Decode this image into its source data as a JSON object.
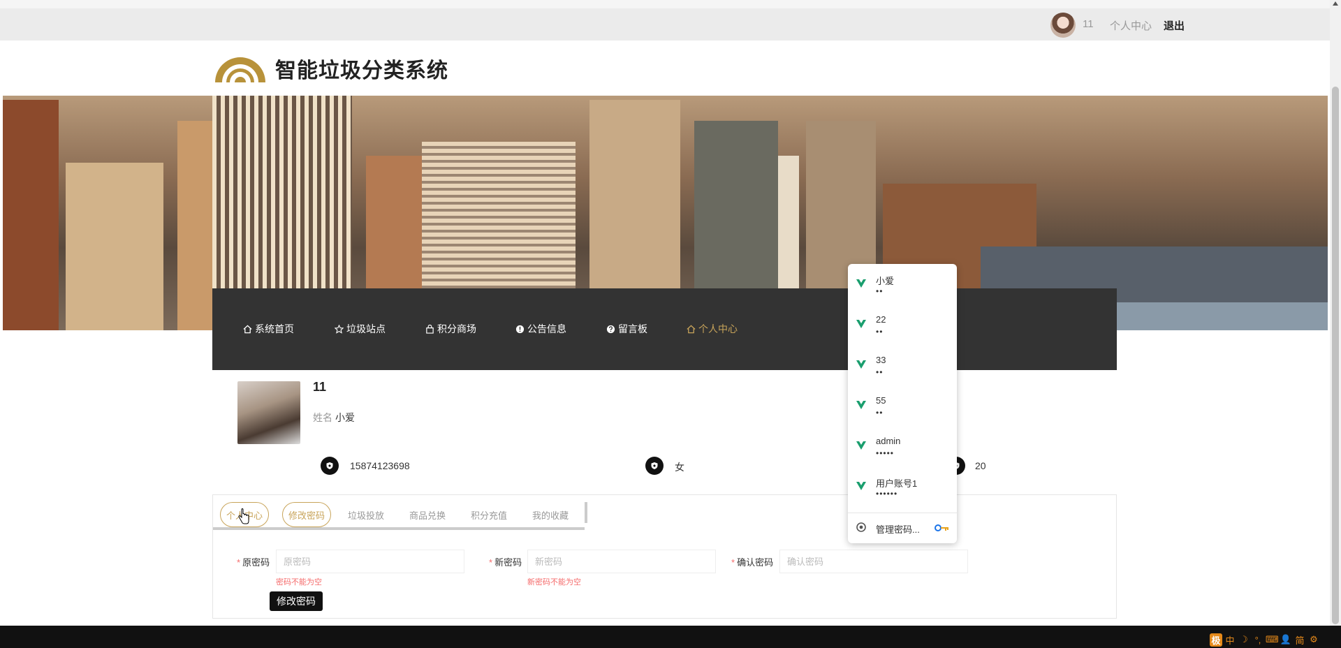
{
  "topbar": {
    "username": "11",
    "center_link": "个人中心",
    "logout": "退出"
  },
  "header": {
    "site_title": "智能垃圾分类系统"
  },
  "nav": {
    "items": [
      {
        "label": "系统首页",
        "icon": "home-icon"
      },
      {
        "label": "垃圾站点",
        "icon": "star-icon"
      },
      {
        "label": "积分商场",
        "icon": "bag-icon"
      },
      {
        "label": "公告信息",
        "icon": "info-icon"
      },
      {
        "label": "留言板",
        "icon": "question-icon"
      },
      {
        "label": "个人中心",
        "icon": "home-icon",
        "active": true
      }
    ]
  },
  "profile": {
    "account": "11",
    "name_label": "姓名",
    "name": "小爱",
    "phone": "15874123698",
    "gender": "女",
    "age": "20"
  },
  "tabs": {
    "items": [
      "个人中心",
      "修改密码",
      "垃圾投放",
      "商品兑换",
      "积分充值",
      "我的收藏"
    ],
    "active": "修改密码"
  },
  "form": {
    "old_label": "原密码",
    "old_placeholder": "原密码",
    "old_error": "密码不能为空",
    "new_label": "新密码",
    "new_placeholder": "新密码",
    "new_error": "新密码不能为空",
    "confirm_label": "确认密码",
    "confirm_placeholder": "确认密码",
    "submit": "修改密码",
    "required_mark": "*"
  },
  "password_dropdown": {
    "items": [
      {
        "account": "小爱",
        "masked": "••"
      },
      {
        "account": "22",
        "masked": "••"
      },
      {
        "account": "33",
        "masked": "••"
      },
      {
        "account": "55",
        "masked": "••"
      },
      {
        "account": "admin",
        "masked": "•••••"
      },
      {
        "account": "用户账号1",
        "masked": "••••••"
      }
    ],
    "manage": "管理密码..."
  },
  "ime": {
    "items": [
      "极",
      "中",
      "☽",
      "°,",
      "⌨",
      "👤",
      "简",
      "⚙"
    ]
  },
  "colors": {
    "accent": "#c8a45a",
    "nav_bg": "#333333",
    "error": "#f56c6c",
    "password_icon": "#1a9e6e"
  }
}
